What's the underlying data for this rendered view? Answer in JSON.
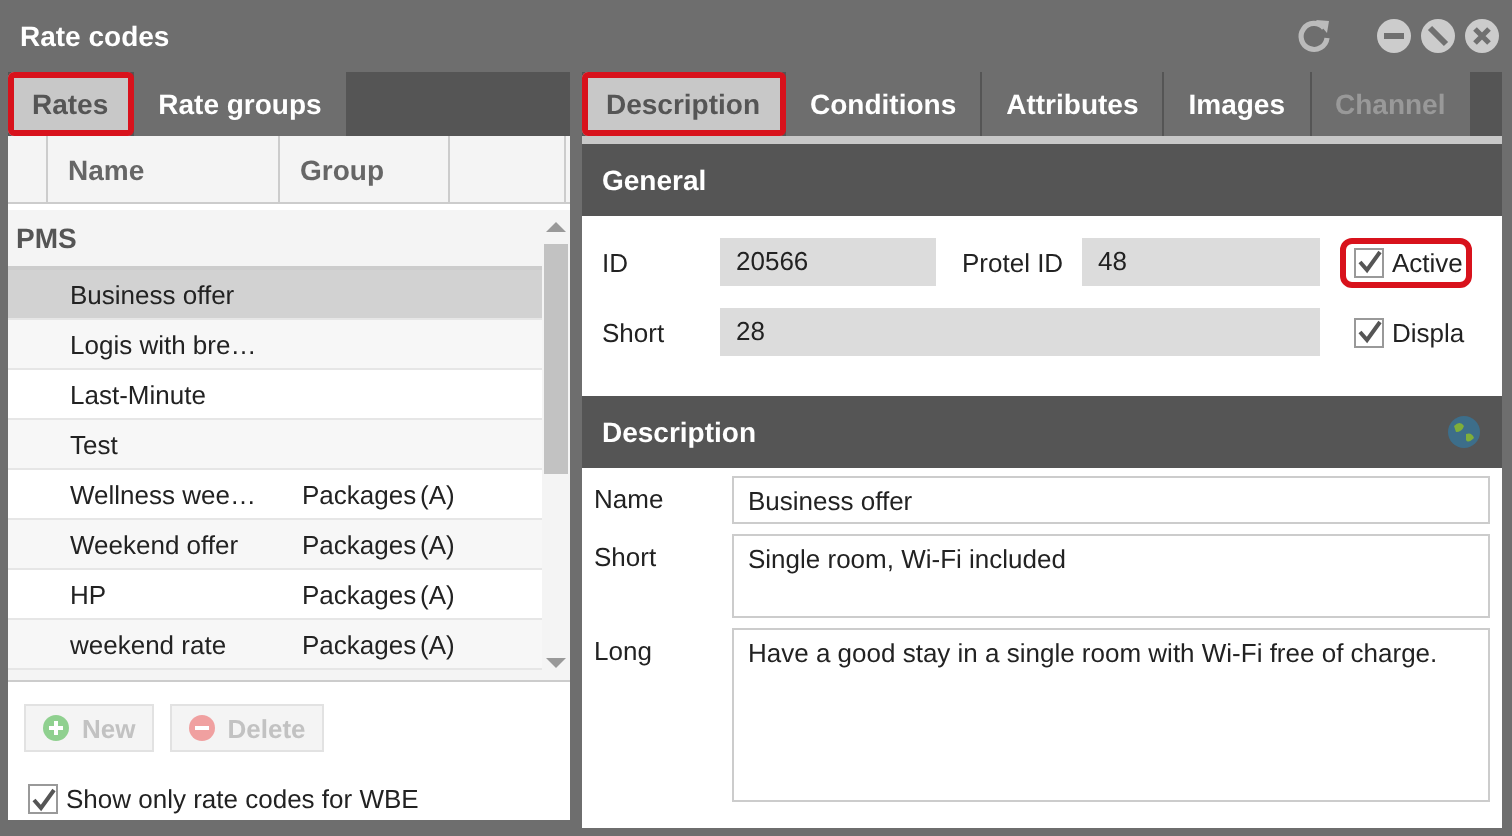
{
  "window": {
    "title": "Rate codes"
  },
  "left_tabs": [
    {
      "label": "Rates",
      "selected": true,
      "highlighted": true
    },
    {
      "label": "Rate groups",
      "selected": false,
      "highlighted": false
    }
  ],
  "table": {
    "columns": [
      {
        "label": "Name"
      },
      {
        "label": "Group"
      }
    ],
    "groups": [
      {
        "label": "PMS",
        "rows": [
          {
            "name": "Business offer",
            "selected": true
          },
          {
            "name": "Logis with bre…",
            "selected": false
          },
          {
            "name": "Last-Minute",
            "selected": false
          },
          {
            "name": "Test",
            "selected": false
          },
          {
            "name": "Wellness wee…",
            "group": "Packages",
            "flag": "(A)",
            "selected": false
          },
          {
            "name": "Weekend offer",
            "group": "Packages",
            "flag": "(A)",
            "selected": false
          },
          {
            "name": "HP",
            "group": "Packages",
            "flag": "(A)",
            "selected": false
          },
          {
            "name": "weekend rate",
            "group": "Packages",
            "flag": "(A)",
            "selected": false
          }
        ]
      }
    ]
  },
  "list_buttons": [
    {
      "label": "New",
      "kind": "add",
      "disabled": true
    },
    {
      "label": "Delete",
      "kind": "remove",
      "disabled": true
    }
  ],
  "filter": {
    "label": "Show only rate codes for WBE",
    "checked": true
  },
  "right_tabs": [
    {
      "label": "Description",
      "selected": true,
      "highlighted": true,
      "disabled": false
    },
    {
      "label": "Conditions",
      "selected": false,
      "highlighted": false,
      "disabled": false
    },
    {
      "label": "Attributes",
      "selected": false,
      "highlighted": false,
      "disabled": false
    },
    {
      "label": "Images",
      "selected": false,
      "highlighted": false,
      "disabled": false
    },
    {
      "label": "Channel",
      "selected": false,
      "highlighted": false,
      "disabled": true
    }
  ],
  "general": {
    "title": "General",
    "id_label": "ID",
    "id": "20566",
    "protel_label": "Protel ID",
    "protel_id": "48",
    "short_label": "Short",
    "short": "28",
    "active": {
      "label": "Active",
      "checked": true,
      "highlighted": true
    },
    "display": {
      "label": "Displa",
      "checked": true
    }
  },
  "description": {
    "title": "Description",
    "fields": [
      {
        "label": "Name",
        "value": "Business offer",
        "kind": "line"
      },
      {
        "label": "Short",
        "value": "Single room, Wi-Fi included",
        "kind": "short"
      },
      {
        "label": "Long",
        "value": "Have a good stay in a single room with Wi-Fi free of charge.",
        "kind": "long"
      }
    ]
  }
}
